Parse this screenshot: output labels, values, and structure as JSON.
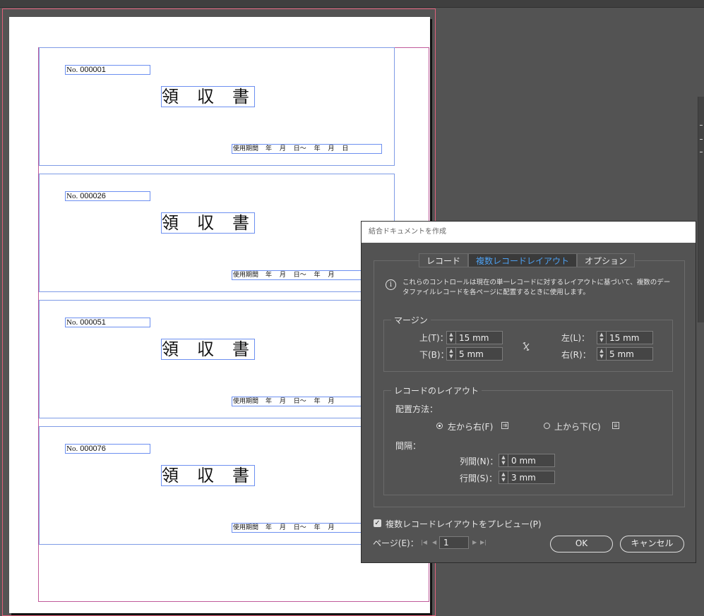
{
  "document": {
    "records": [
      {
        "no_label": "No.",
        "no_value": "000001",
        "title": "領収書",
        "period_label": "使用期間",
        "period_text": "年 月 日～ 年 月 日"
      },
      {
        "no_label": "No.",
        "no_value": "000026",
        "title": "領収書",
        "period_label": "使用期間",
        "period_text": "年 月 日～ 年 月"
      },
      {
        "no_label": "No.",
        "no_value": "000051",
        "title": "領収書",
        "period_label": "使用期間",
        "period_text": "年 月 日～ 年 月"
      },
      {
        "no_label": "No.",
        "no_value": "000076",
        "title": "領収書",
        "period_label": "使用期間",
        "period_text": "年 月 日～ 年 月"
      }
    ]
  },
  "dialog": {
    "title": "結合ドキュメントを作成",
    "tabs": [
      {
        "label": "レコード",
        "active": false
      },
      {
        "label": "複数レコードレイアウト",
        "active": true
      },
      {
        "label": "オプション",
        "active": false
      }
    ],
    "info_text": "これらのコントロールは現在の単一レコードに対するレイアウトに基づいて、複数のデータファイルレコードを各ページに配置するときに使用します。",
    "margins": {
      "legend": "マージン",
      "top_label": "上(T)：",
      "top_value": "15 mm",
      "bottom_label": "下(B)：",
      "bottom_value": "5 mm",
      "left_label": "左(L)：",
      "left_value": "15 mm",
      "right_label": "右(R)：",
      "right_value": "5 mm"
    },
    "record_layout": {
      "legend": "レコードのレイアウト",
      "placement_label": "配置方法：",
      "option_lr": "左から右(F)",
      "option_tb": "上から下(C)",
      "spacing_label": "間隔：",
      "column_label": "列間(N)：",
      "column_value": "0 mm",
      "row_label": "行間(S)：",
      "row_value": "3 mm"
    },
    "preview_label": "複数レコードレイアウトをプレビュー(P)",
    "page_label": "ページ(E)：",
    "page_value": "1",
    "ok_label": "OK",
    "cancel_label": "キャンセル"
  }
}
